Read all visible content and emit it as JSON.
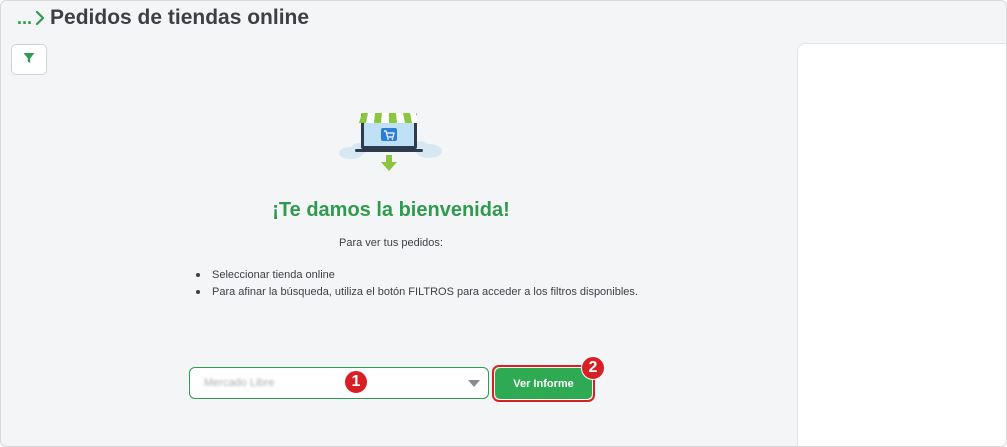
{
  "header": {
    "breadcrumb_ellipsis": "...",
    "title": "Pedidos de tiendas online"
  },
  "toolbar": {
    "filter_icon": "filter-funnel-icon"
  },
  "empty_state": {
    "illustration": "online-store-download-illustration",
    "title": "¡Te damos la bienvenida!",
    "subtitle": "Para ver tus pedidos:",
    "steps": [
      "Seleccionar tienda online",
      "Para afinar la búsqueda, utiliza el botón FILTROS para acceder a los filtros disponibles."
    ]
  },
  "form": {
    "store_select_value": "Mercado Libre",
    "report_button_label": "Ver Informe"
  },
  "annotations": {
    "badge_1": "1",
    "badge_2": "2"
  },
  "colors": {
    "brand_green": "#2e9b4e",
    "button_green": "#2eaa52",
    "annotation_red": "#d81f26",
    "text_dark": "#3c3f44",
    "background": "#f4f5f7"
  }
}
